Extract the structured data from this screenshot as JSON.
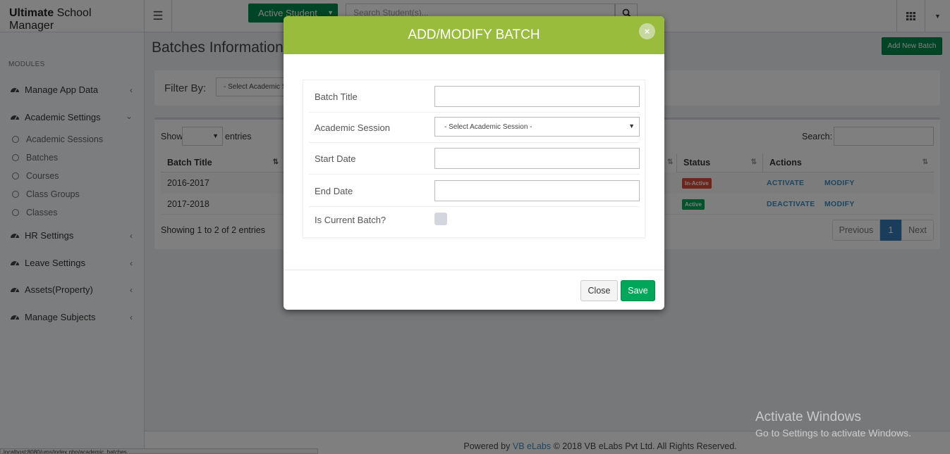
{
  "topbar": {
    "brand_bold": "Ultimate",
    "brand_rest": " School Manager",
    "active_student_label": "Active Student",
    "search_placeholder": "Search Student(s)..."
  },
  "sidebar": {
    "modules_label": "MODULES",
    "items": [
      {
        "label": "Manage App Data",
        "icon": "dashboard-icon",
        "chevron": "chevron-left-icon"
      },
      {
        "label": "Academic Settings",
        "icon": "dashboard-icon",
        "chevron": "chevron-down-icon"
      },
      {
        "label": "HR Settings",
        "icon": "dashboard-icon",
        "chevron": "chevron-left-icon"
      },
      {
        "label": "Leave Settings",
        "icon": "dashboard-icon",
        "chevron": "chevron-left-icon"
      },
      {
        "label": "Assets(Property)",
        "icon": "dashboard-icon",
        "chevron": "chevron-left-icon"
      },
      {
        "label": "Manage Subjects",
        "icon": "dashboard-icon",
        "chevron": "chevron-left-icon"
      }
    ],
    "sub_items": [
      "Academic Sessions",
      "Batches",
      "Courses",
      "Class Groups",
      "Classes"
    ]
  },
  "content": {
    "page_title": "Batches Information",
    "add_button": "Add New Batch",
    "filter_label": "Filter By:",
    "filter_select": "- Select Academic S",
    "show_label": "Show",
    "entries_label": "entries",
    "search_label": "Search:",
    "columns": [
      "Batch Title",
      "Status",
      "Actions"
    ],
    "rows": [
      {
        "title": "2016-2017",
        "status": "In-Active",
        "status_color": "#dd4b39",
        "action1": "ACTIVATE",
        "action2": "MODIFY"
      },
      {
        "title": "2017-2018",
        "status": "Active",
        "status_color": "#00a65a",
        "action1": "DEACTIVATE",
        "action2": "MODIFY"
      }
    ],
    "showing": "Showing 1 to 2 of 2 entries",
    "pager": {
      "previous": "Previous",
      "current": "1",
      "next": "Next"
    }
  },
  "footer": {
    "powered_by": "Powered by",
    "link": "VB eLabs",
    "copyright": "© 2018 VB eLabs Pvt Ltd. All Rights Reserved."
  },
  "status_url": "localhost:8080/ums/index.php/academic_batches",
  "watermark": {
    "line1": "Activate Windows",
    "line2": "Go to Settings to activate Windows."
  },
  "modal": {
    "title": "ADD/MODIFY BATCH",
    "close_glyph": "×",
    "fields": {
      "batch_title": "Batch Title",
      "academic_session": "Academic Session",
      "academic_session_value": "- Select Academic Session -",
      "start_date": "Start Date",
      "end_date": "End Date",
      "is_current": "Is Current Batch?"
    },
    "close_button": "Close",
    "save_button": "Save"
  },
  "colors": {
    "modal_header": "#9abc3d",
    "primary_green": "#008d4c",
    "link_blue": "#3c8dbc"
  }
}
